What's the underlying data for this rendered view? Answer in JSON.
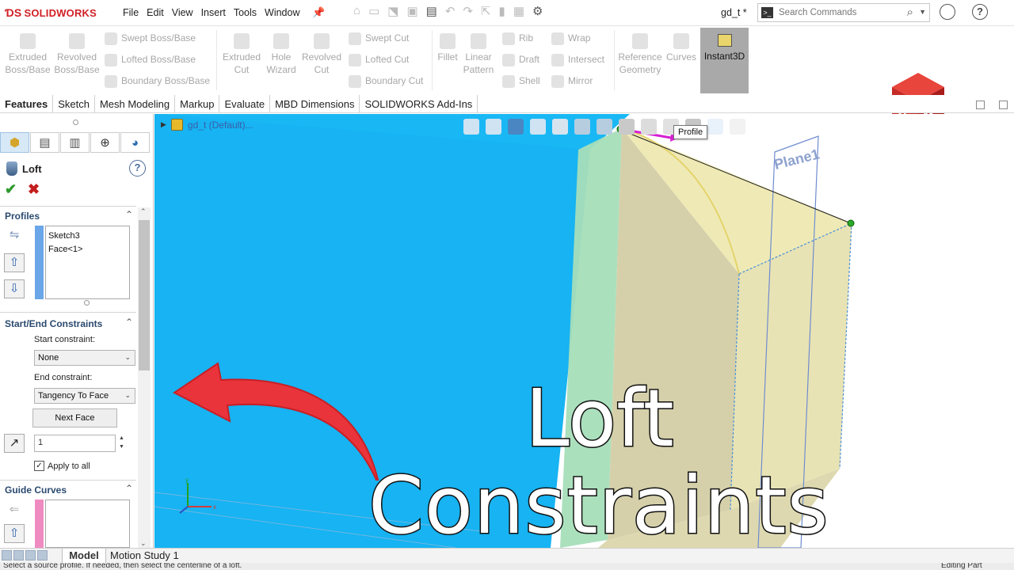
{
  "app": {
    "brand": "SOLIDWORKS",
    "menus": [
      "File",
      "Edit",
      "View",
      "Insert",
      "Tools",
      "Window"
    ],
    "document_title": "gd_t *",
    "search": {
      "placeholder": "Search Commands"
    }
  },
  "ribbon": {
    "large_buttons": [
      {
        "label": "Extruded\nBoss/Base",
        "icon": "extruded-boss-icon"
      },
      {
        "label": "Revolved\nBoss/Base",
        "icon": "revolved-boss-icon"
      },
      {
        "label": "Extruded\nCut",
        "icon": "extruded-cut-icon"
      },
      {
        "label": "Hole\nWizard",
        "icon": "hole-wizard-icon"
      },
      {
        "label": "Revolved\nCut",
        "icon": "revolved-cut-icon"
      },
      {
        "label": "Fillet",
        "icon": "fillet-icon"
      },
      {
        "label": "Linear\nPattern",
        "icon": "linear-pattern-icon"
      },
      {
        "label": "Reference\nGeometry",
        "icon": "reference-geometry-icon"
      },
      {
        "label": "Curves",
        "icon": "curves-icon"
      }
    ],
    "small_buttons": [
      {
        "label": "Swept Boss/Base"
      },
      {
        "label": "Lofted Boss/Base"
      },
      {
        "label": "Boundary Boss/Base"
      },
      {
        "label": "Swept Cut"
      },
      {
        "label": "Lofted Cut"
      },
      {
        "label": "Boundary Cut"
      },
      {
        "label": "Rib"
      },
      {
        "label": "Draft"
      },
      {
        "label": "Shell"
      },
      {
        "label": "Wrap"
      },
      {
        "label": "Intersect"
      },
      {
        "label": "Mirror"
      }
    ],
    "instant3d_label": "Instant3D",
    "tabs": [
      "Features",
      "Sketch",
      "Mesh Modeling",
      "Markup",
      "Evaluate",
      "MBD Dimensions",
      "SOLIDWORKS Add-Ins"
    ],
    "active_tab": "Features"
  },
  "property_manager": {
    "feature_name": "Loft",
    "profiles": {
      "title": "Profiles",
      "items": [
        "Sketch3",
        "Face<1>"
      ],
      "color": "#6aa6e8"
    },
    "constraints": {
      "title": "Start/End Constraints",
      "start_label": "Start constraint:",
      "start_value": "None",
      "end_label": "End constraint:",
      "end_value": "Tangency To Face",
      "next_face_label": "Next Face",
      "tangent_length": "1",
      "apply_all_label": "Apply to all",
      "apply_all_checked": true
    },
    "guide_curves": {
      "title": "Guide Curves",
      "color": "#f08bc1"
    }
  },
  "graphics": {
    "tree_flyout_label": "gd_t (Default)...",
    "tooltip": "Profile",
    "plane_label": "Plane1",
    "overlay_line1": "Loft",
    "overlay_line2": "Constraints",
    "colors": {
      "face_blue": "#17b3f2",
      "loft_yellow": "#e7e3ae",
      "arrow_red": "#e8343a"
    },
    "triad_x": "x",
    "triad_y": "y"
  },
  "bottom": {
    "tabs": [
      "Model",
      "Motion Study 1"
    ],
    "active_tab": "Model",
    "status_message": "Select a source profile. If needed, then select the centerline of a loft.",
    "status_mode": "Editing Part"
  }
}
